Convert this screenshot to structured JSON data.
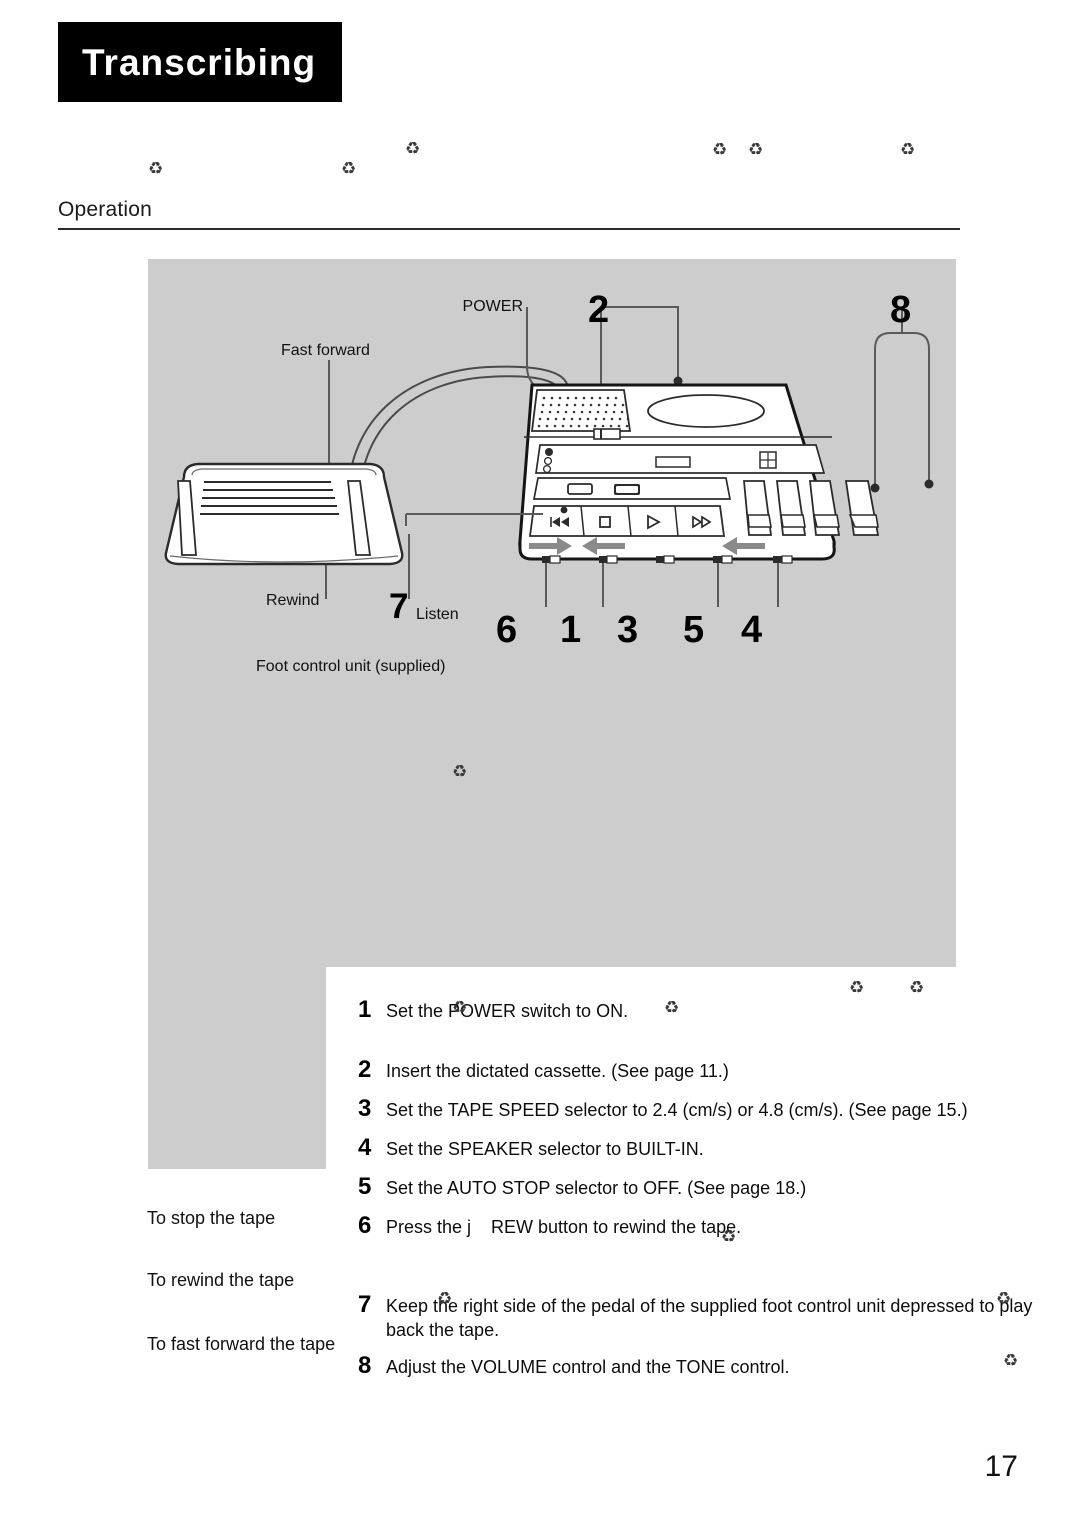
{
  "chapter": {
    "title": "Transcribing"
  },
  "section": {
    "heading": "Operation"
  },
  "figure": {
    "labels": {
      "power": "POWER",
      "fast_forward": "Fast forward",
      "rewind": "Rewind",
      "listen": "Listen",
      "foot_control_caption": "Foot control unit (supplied)"
    },
    "callouts": {
      "power_num": "2",
      "tone_num": "8",
      "listen_num": "7",
      "rew_num": "6",
      "n1": "1",
      "n3": "3",
      "n5": "5",
      "n4": "4"
    },
    "device_controls": {
      "rew_button": "REW",
      "stop_button": "STOP",
      "play_button": "PLAY",
      "ff_button": "FF"
    },
    "background_color": "#cdcdcd"
  },
  "instructions": [
    {
      "num": "1",
      "text": "Set the POWER switch to ON."
    },
    {
      "num": "2",
      "text": "Insert the dictated cassette. (See page 11.)"
    },
    {
      "num": "3",
      "text": "Set the TAPE SPEED selector to 2.4 (cm/s) or 4.8 (cm/s). (See page 15.)"
    },
    {
      "num": "4",
      "text": "Set the SPEAKER selector to BUILT-IN."
    },
    {
      "num": "5",
      "text": "Set the AUTO STOP selector to OFF. (See page 18.)"
    },
    {
      "num": "6",
      "text": "Press the j    REW button to rewind the tape."
    },
    {
      "num": "7",
      "text": "Keep the right side of the pedal of the supplied foot control unit depressed to play back the tape."
    },
    {
      "num": "8",
      "text": "Adjust the VOLUME control and the TONE control."
    }
  ],
  "bottom_notes": [
    {
      "text": "To stop the tape"
    },
    {
      "text": "To rewind the tape"
    },
    {
      "text": "To fast forward the tape"
    }
  ],
  "glyphs": {
    "headphone": "͓"
  },
  "page": {
    "number": "17"
  }
}
